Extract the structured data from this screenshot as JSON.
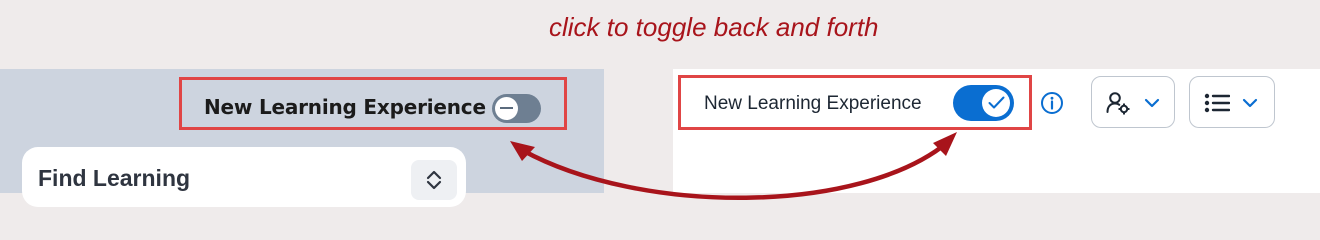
{
  "annotation": {
    "caption": "click to toggle back and forth"
  },
  "old_ui": {
    "toggle_label": "New Learning Experience",
    "toggle_state": "off",
    "card_title": "Find Learning"
  },
  "new_ui": {
    "toggle_label": "New Learning Experience",
    "toggle_state": "on",
    "buttons": [
      {
        "icon": "user-settings-icon"
      },
      {
        "icon": "list-icon"
      }
    ]
  },
  "colors": {
    "annotation": "#a8141b",
    "highlight": "#e04545",
    "toggle_on": "#0a6ed1",
    "toggle_off": "#6e7f92"
  }
}
